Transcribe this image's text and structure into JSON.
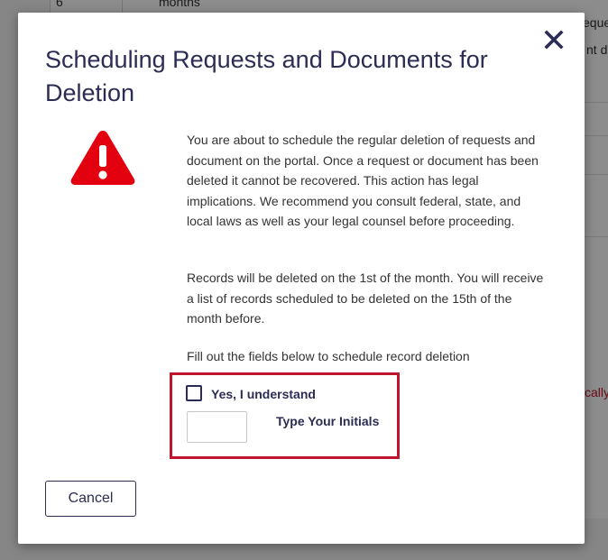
{
  "background": {
    "cell_number": "6",
    "cell_text": "months",
    "right_text_1": "eque",
    "right_text_2": "nt d",
    "right_text_3": "cally"
  },
  "modal": {
    "title": "Scheduling Requests and Documents for Deletion",
    "close_icon": "close-icon",
    "warning_icon": "warning-triangle-icon",
    "paragraph_1": "You are about to schedule the regular deletion of requests and document on the portal. Once a request or document has been deleted it cannot be recovered. This action has legal implications. We recommend you consult federal, state, and local laws as well as your legal counsel before proceeding.",
    "paragraph_2": "Records will be deleted on the 1st of the month. You will receive a list of records scheduled to be deleted on the 15th of the month before.",
    "paragraph_3": "Fill out the fields below to schedule record deletion",
    "checkbox_label": "Yes, I understand",
    "checkbox_checked": false,
    "initials_label": "Type Your Initials",
    "initials_value": "",
    "initials_placeholder": "",
    "cancel_label": "Cancel"
  },
  "colors": {
    "primary": "#2c2c54",
    "danger": "#c0162d",
    "warning_icon": "#e3000f"
  }
}
